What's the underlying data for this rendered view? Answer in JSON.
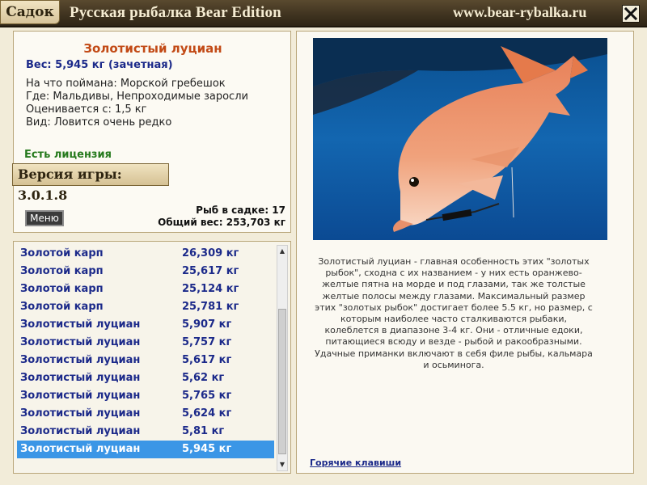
{
  "titlebar": {
    "tab_label": "Садок",
    "app_title": "Русская рыбалка Bear Edition",
    "site": "www.bear-rybalka.ru",
    "close_icon": "close-icon"
  },
  "info": {
    "fish_name": "Золотистый луциан",
    "weight": "Вес: 5,945 кг (зачетная)",
    "lines": [
      "На что поймана: Морской гребешок",
      "Где: Мальдивы, Непроходимые заросли",
      "Оценивается с: 1,5 кг",
      "Вид: Ловится очень редко"
    ],
    "license": "Есть лицензия",
    "version": "Версия игры: 3.0.1.8",
    "menu_label": "Меню",
    "fish_count": "Рыб в садке: 17",
    "total_weight": "Общий вес: 253,703 кг"
  },
  "list": {
    "rows": [
      {
        "name": "Золотой карп",
        "weight": "26,309 кг"
      },
      {
        "name": "Золотой карп",
        "weight": "25,617 кг"
      },
      {
        "name": "Золотой карп",
        "weight": "25,124 кг"
      },
      {
        "name": "Золотой карп",
        "weight": "25,781 кг"
      },
      {
        "name": "Золотистый луциан",
        "weight": "5,907 кг"
      },
      {
        "name": "Золотистый луциан",
        "weight": "5,757 кг"
      },
      {
        "name": "Золотистый луциан",
        "weight": "5,617 кг"
      },
      {
        "name": "Золотистый луциан",
        "weight": "5,62 кг"
      },
      {
        "name": "Золотистый луциан",
        "weight": "5,765 кг"
      },
      {
        "name": "Золотистый луциан",
        "weight": "5,624 кг"
      },
      {
        "name": "Золотистый луциан",
        "weight": "5,81 кг"
      },
      {
        "name": "Золотистый луциан",
        "weight": "5,945 кг"
      }
    ],
    "selected_index": 11
  },
  "detail": {
    "description": [
      "Золотистый луциан - главная особенность этих \"золотых",
      "рыбок\", сходна с их названием - у них есть оранжево-",
      "желтые пятна на морде и под глазами, так же толстые",
      "желтые полосы между глазами. Максимальный размер",
      "этих \"золотых рыбок\" достигает более 5.5 кг, но размер, с",
      "которым наиболее часто сталкиваются рыбаки,",
      "колеблется в диапазоне 3-4 кг. Они - отличные едоки,",
      "питающиеся всюду и везде - рыбой и ракообразными.",
      "Удачные приманки включают в себя филе рыбы, кальмара",
      "и осьминога."
    ],
    "hotkeys_link": "Горячие клавиши"
  },
  "colors": {
    "titlebar": "#3e321f",
    "fish_title": "#c24a16",
    "list_text": "#1c2a8a",
    "selected_row": "#3b96e6",
    "license": "#267a1d"
  }
}
